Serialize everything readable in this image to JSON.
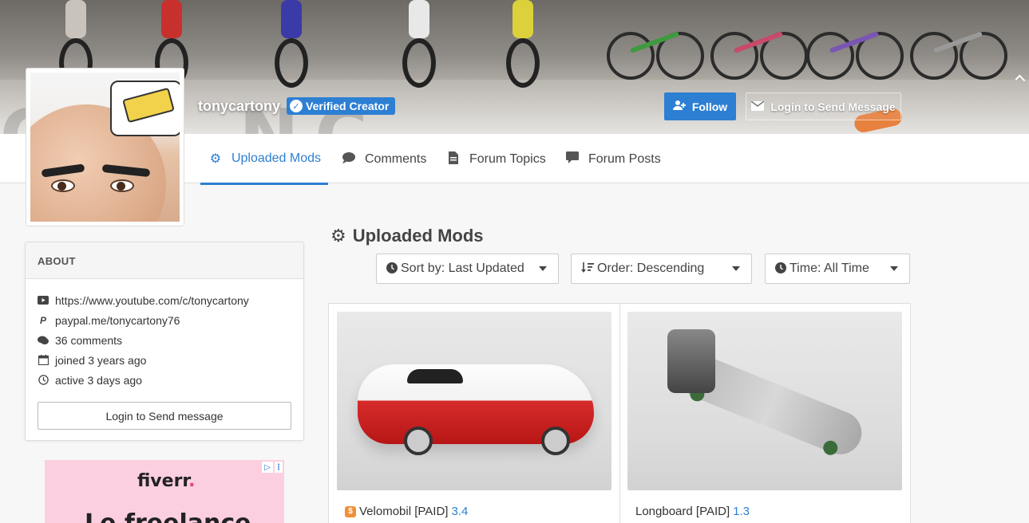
{
  "profile": {
    "username": "tonycartony",
    "verified_label": "Verified Creator",
    "follow_label": "Follow",
    "login_message_label": "Login to Send Message"
  },
  "tabs": [
    {
      "label": "Uploaded Mods",
      "icon": "gears-icon",
      "active": true
    },
    {
      "label": "Comments",
      "icon": "comment-icon",
      "active": false
    },
    {
      "label": "Forum Topics",
      "icon": "file-icon",
      "active": false
    },
    {
      "label": "Forum Posts",
      "icon": "message-icon",
      "active": false
    }
  ],
  "about": {
    "heading": "ABOUT",
    "items": [
      {
        "icon": "youtube-icon",
        "text": "https://www.youtube.com/c/tonycartony"
      },
      {
        "icon": "paypal-icon",
        "text": "paypal.me/tonycartony76"
      },
      {
        "icon": "comments-icon",
        "text": "36 comments"
      },
      {
        "icon": "calendar-icon",
        "text": "joined 3 years ago"
      },
      {
        "icon": "clock-icon",
        "text": "active 3 days ago"
      }
    ],
    "button_label": "Login to Send message"
  },
  "ad": {
    "brand": "fiverr",
    "brand_dot": ".",
    "headline": "Le freelance"
  },
  "mods": {
    "title": "Uploaded Mods",
    "sort_label": "Sort by: Last Updated",
    "order_label": "Order: Descending",
    "time_label": "Time: All Time",
    "items": [
      {
        "name": "Velomobil [PAID]",
        "version": "3.4",
        "paid_badge": "$"
      },
      {
        "name": "Longboard [PAID]",
        "version": "1.3"
      }
    ]
  },
  "colors": {
    "accent": "#2d7fd3",
    "paid": "#f0903a"
  }
}
